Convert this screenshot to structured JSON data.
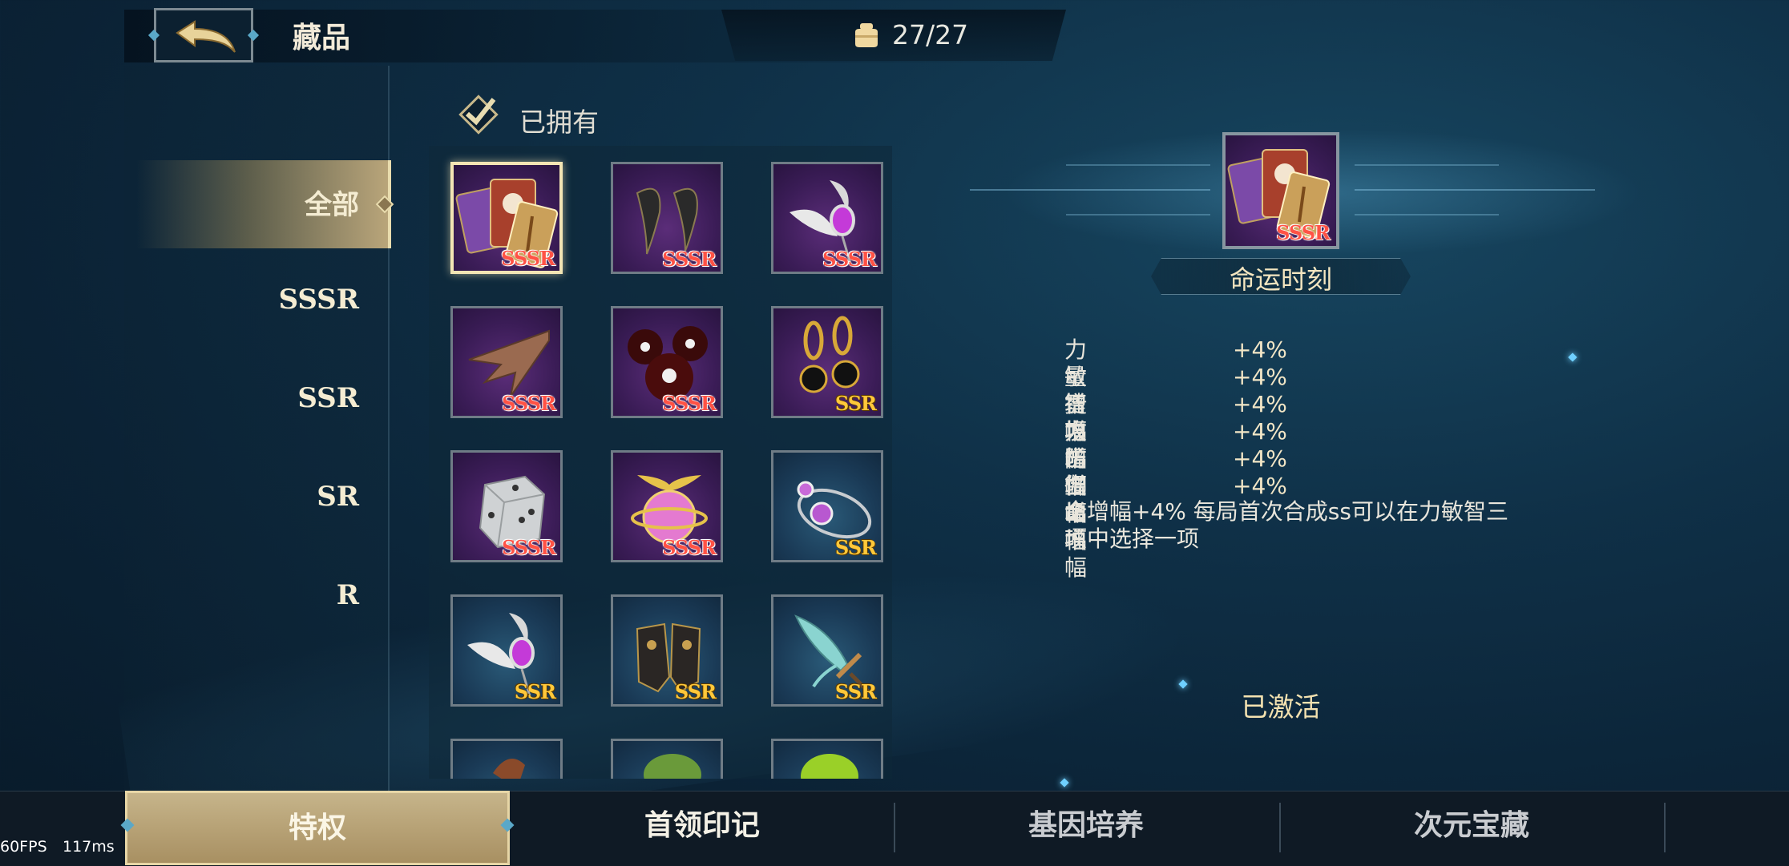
{
  "header": {
    "back_icon": "back-arrow-icon",
    "title": "藏品",
    "counter_icon": "bag-icon",
    "counter": "27/27"
  },
  "categories": [
    {
      "label": "全部",
      "active": true
    },
    {
      "label": "SSSR",
      "active": false
    },
    {
      "label": "SSR",
      "active": false
    },
    {
      "label": "SR",
      "active": false
    },
    {
      "label": "R",
      "active": false
    }
  ],
  "filter": {
    "owned_label": "已拥有",
    "checked": true
  },
  "items": [
    {
      "name": "cards-item",
      "rarity": "SSSR",
      "bg": "purple",
      "selected": true
    },
    {
      "name": "claws-item",
      "rarity": "SSSR",
      "bg": "purple"
    },
    {
      "name": "feather-pendant-item",
      "rarity": "SSSR",
      "bg": "purple"
    },
    {
      "name": "wing-item",
      "rarity": "SSSR",
      "bg": "purple"
    },
    {
      "name": "skull-orbs-item",
      "rarity": "SSSR",
      "bg": "purple"
    },
    {
      "name": "clover-earrings-item",
      "rarity": "SSR",
      "bg": "purple"
    },
    {
      "name": "dice-item",
      "rarity": "SSSR",
      "bg": "purple"
    },
    {
      "name": "winged-orb-item",
      "rarity": "SSSR",
      "bg": "purple"
    },
    {
      "name": "bracelet-item",
      "rarity": "SSR",
      "bg": "blue"
    },
    {
      "name": "feather-pendant-item-2",
      "rarity": "SSR",
      "bg": "blue"
    },
    {
      "name": "gloves-item",
      "rarity": "SSR",
      "bg": "blue"
    },
    {
      "name": "sword-item",
      "rarity": "SSR",
      "bg": "blue"
    },
    {
      "name": "partial-item-1",
      "rarity": "",
      "bg": "blue"
    },
    {
      "name": "partial-item-2",
      "rarity": "",
      "bg": "blue"
    },
    {
      "name": "partial-item-3",
      "rarity": "",
      "bg": "blue"
    }
  ],
  "detail": {
    "name": "命运时刻",
    "rarity": "SSSR",
    "stats": [
      {
        "name": "力量增幅",
        "value": "+4%"
      },
      {
        "name": "敏捷增幅",
        "value": "+4%"
      },
      {
        "name": "智力增幅",
        "value": "+4%"
      },
      {
        "name": "攻击增幅",
        "value": "+4%"
      },
      {
        "name": "防御增幅",
        "value": "+4%"
      },
      {
        "name": "生命增幅",
        "value": "+4%"
      }
    ],
    "description": "全增幅+4% 每局首次合成ss可以在力敏智三项中选择一项",
    "status": "已激活"
  },
  "tabs": [
    {
      "label": "特权",
      "active": true,
      "color": "#fbf6e6"
    },
    {
      "label": "首领印记",
      "active": false,
      "color": "#f4f1e6"
    },
    {
      "label": "基因培养",
      "active": false,
      "color": "#c9ccd0"
    },
    {
      "label": "次元宝藏",
      "active": false,
      "color": "#c9ccd0"
    }
  ],
  "perf": {
    "fps": "60FPS",
    "ms": "117ms"
  },
  "colors": {
    "sssr": "#ff5245",
    "ssr": "#ffc83a",
    "accent": "#e7d6a6"
  }
}
